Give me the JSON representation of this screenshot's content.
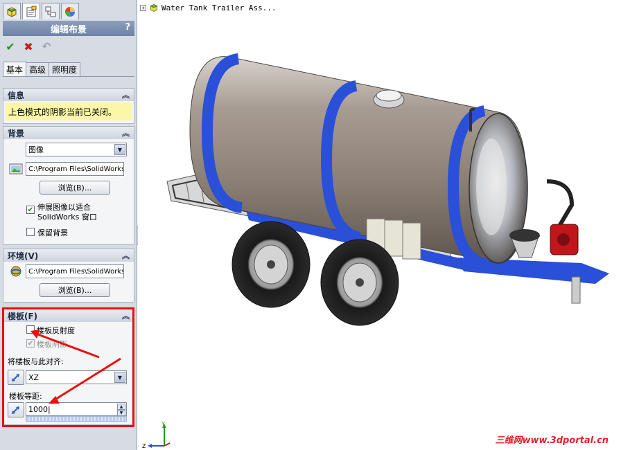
{
  "manager_tabs": [
    {
      "name": "featuremanager-icon"
    },
    {
      "name": "propertymanager-icon"
    },
    {
      "name": "configurationmanager-icon"
    },
    {
      "name": "displaymanager-icon"
    }
  ],
  "panel": {
    "title": "编辑布景",
    "help": "?"
  },
  "actions": {
    "ok": "✔",
    "cancel": "✖",
    "undo": "↶"
  },
  "tabs": [
    {
      "label": "基本",
      "active": true
    },
    {
      "label": "高级",
      "active": false
    },
    {
      "label": "照明度",
      "active": false
    }
  ],
  "info": {
    "header": "信息",
    "message": "上色模式的阴影当前已关闭。"
  },
  "background": {
    "header": "背景",
    "type": "图像",
    "path": "C:\\Program Files\\SolidWorks",
    "browse": "浏览(B)...",
    "stretch_label_line1": "伸展图像以适合",
    "stretch_label_line2": "SolidWorks 窗口",
    "stretch_checked": true,
    "keep_label": "保留背景",
    "keep_checked": false
  },
  "environment": {
    "header": "环境(V)",
    "path": "C:\\Program Files\\SolidWorks",
    "browse": "浏览(B)..."
  },
  "floor": {
    "header": "楼板(F)",
    "reflectivity_label": "楼板反射度",
    "reflectivity_checked": false,
    "shadows_label": "楼板阴影",
    "shadows_checked": true,
    "align_label": "将楼板与此对齐:",
    "align_value": "XZ",
    "offset_label": "楼板等距:",
    "offset_value": "1000"
  },
  "graphics": {
    "tree_root": "Water Tank Trailer Ass...",
    "triad": {
      "x": "X",
      "y": "Y",
      "z": "Z"
    },
    "watermark": "三维网www.3dportal.cn"
  },
  "colors": {
    "annotation": "#e81010",
    "tank_band": "#2a4fd8",
    "title_bar": "#7488ab",
    "info_bg": "#fbf6a8"
  }
}
